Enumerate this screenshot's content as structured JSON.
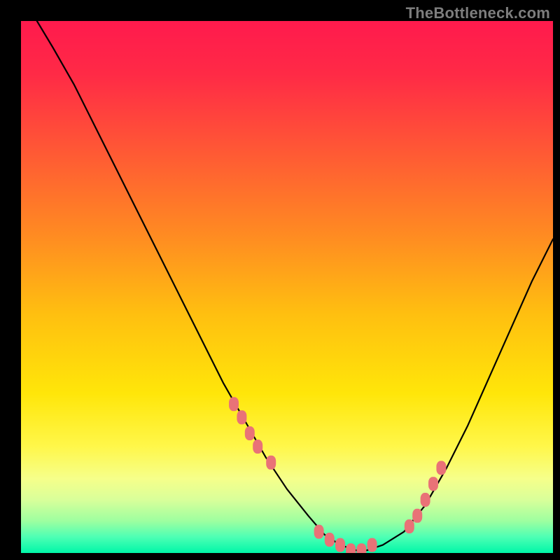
{
  "watermark": "TheBottleneck.com",
  "colors": {
    "frame": "#000000",
    "gradient_stops": [
      {
        "offset": 0.0,
        "color": "#ff1a4d"
      },
      {
        "offset": 0.1,
        "color": "#ff2a46"
      },
      {
        "offset": 0.25,
        "color": "#ff5a34"
      },
      {
        "offset": 0.4,
        "color": "#ff8a22"
      },
      {
        "offset": 0.55,
        "color": "#ffbf10"
      },
      {
        "offset": 0.7,
        "color": "#ffe609"
      },
      {
        "offset": 0.8,
        "color": "#fff74a"
      },
      {
        "offset": 0.86,
        "color": "#f6ff8a"
      },
      {
        "offset": 0.9,
        "color": "#d9ff9a"
      },
      {
        "offset": 0.94,
        "color": "#9dffa0"
      },
      {
        "offset": 0.97,
        "color": "#4dffb4"
      },
      {
        "offset": 1.0,
        "color": "#00f7a8"
      }
    ],
    "curve": "#000000",
    "markers": "#e97277"
  },
  "chart_data": {
    "type": "line",
    "title": "",
    "xlabel": "",
    "ylabel": "",
    "xlim": [
      0,
      100
    ],
    "ylim": [
      0,
      100
    ],
    "grid": false,
    "legend": false,
    "series": [
      {
        "name": "bottleneck-curve",
        "x": [
          0,
          3,
          6,
          10,
          14,
          18,
          22,
          26,
          30,
          34,
          38,
          42,
          46,
          50,
          54,
          57,
          60,
          63,
          65,
          68,
          72,
          76,
          80,
          84,
          88,
          92,
          96,
          100
        ],
        "y": [
          104,
          100,
          95,
          88,
          80,
          72,
          64,
          56,
          48,
          40,
          32,
          25,
          18,
          12,
          7,
          3.5,
          1.5,
          0.5,
          0.5,
          1.5,
          4,
          9,
          16,
          24,
          33,
          42,
          51,
          59
        ]
      }
    ],
    "markers": {
      "name": "highlighted-points",
      "x": [
        40,
        41.5,
        43,
        44.5,
        47,
        56,
        58,
        60,
        62,
        64,
        66,
        73,
        74.5,
        76,
        77.5,
        79
      ],
      "y": [
        28,
        25.5,
        22.5,
        20,
        17,
        4,
        2.5,
        1.5,
        0.5,
        0.5,
        1.5,
        5,
        7,
        10,
        13,
        16
      ]
    }
  }
}
